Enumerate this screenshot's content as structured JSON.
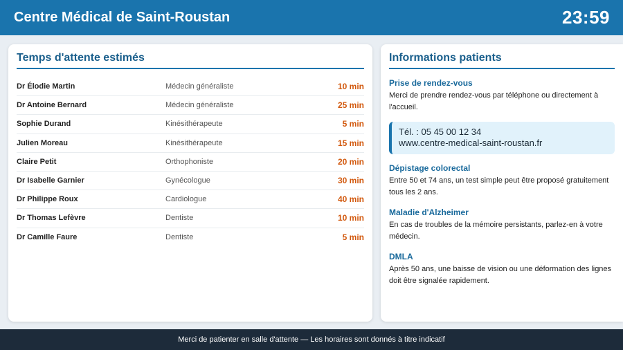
{
  "header": {
    "title": "Centre Médical de Saint-Roustan",
    "clock": "23:59"
  },
  "waiting": {
    "title": "Temps d'attente estimés",
    "rows": [
      {
        "doctor": "Dr Élodie Martin",
        "specialty": "Médecin généraliste",
        "wait": "10 min"
      },
      {
        "doctor": "Dr Antoine Bernard",
        "specialty": "Médecin généraliste",
        "wait": "25 min"
      },
      {
        "doctor": "Sophie Durand",
        "specialty": "Kinésithérapeute",
        "wait": "5 min"
      },
      {
        "doctor": "Julien Moreau",
        "specialty": "Kinésithérapeute",
        "wait": "15 min"
      },
      {
        "doctor": "Claire Petit",
        "specialty": "Orthophoniste",
        "wait": "20 min"
      },
      {
        "doctor": "Dr Isabelle Garnier",
        "specialty": "Gynécologue",
        "wait": "30 min"
      },
      {
        "doctor": "Dr Philippe Roux",
        "specialty": "Cardiologue",
        "wait": "40 min"
      },
      {
        "doctor": "Dr Thomas Lefèvre",
        "specialty": "Dentiste",
        "wait": "10 min"
      },
      {
        "doctor": "Dr Camille Faure",
        "specialty": "Dentiste",
        "wait": "5 min"
      }
    ]
  },
  "info": {
    "title": "Informations patients",
    "appointment": {
      "heading": "Prise de rendez-vous",
      "text": "Merci de prendre rendez-vous par téléphone ou directement à l'accueil."
    },
    "contact": {
      "phone": "Tél. : 05 45 00 12 34",
      "website": "www.centre-medical-saint-roustan.fr"
    },
    "blocks": [
      {
        "heading": "Dépistage colorectal",
        "text": "Entre 50 et 74 ans, un test simple peut être proposé gratuitement tous les 2 ans."
      },
      {
        "heading": "Maladie d'Alzheimer",
        "text": "En cas de troubles de la mémoire persistants, parlez-en à votre médecin."
      },
      {
        "heading": "DMLA",
        "text": "Après 50 ans, une baisse de vision ou une déformation des lignes doit être signalée rapidement."
      }
    ]
  },
  "footer": {
    "text": "Merci de patienter en salle d'attente — Les horaires sont donnés à titre indicatif"
  },
  "colors": {
    "header_bg": "#1a74ad",
    "wait_time": "#d2590e",
    "footer_bg": "#1d2b3a"
  }
}
